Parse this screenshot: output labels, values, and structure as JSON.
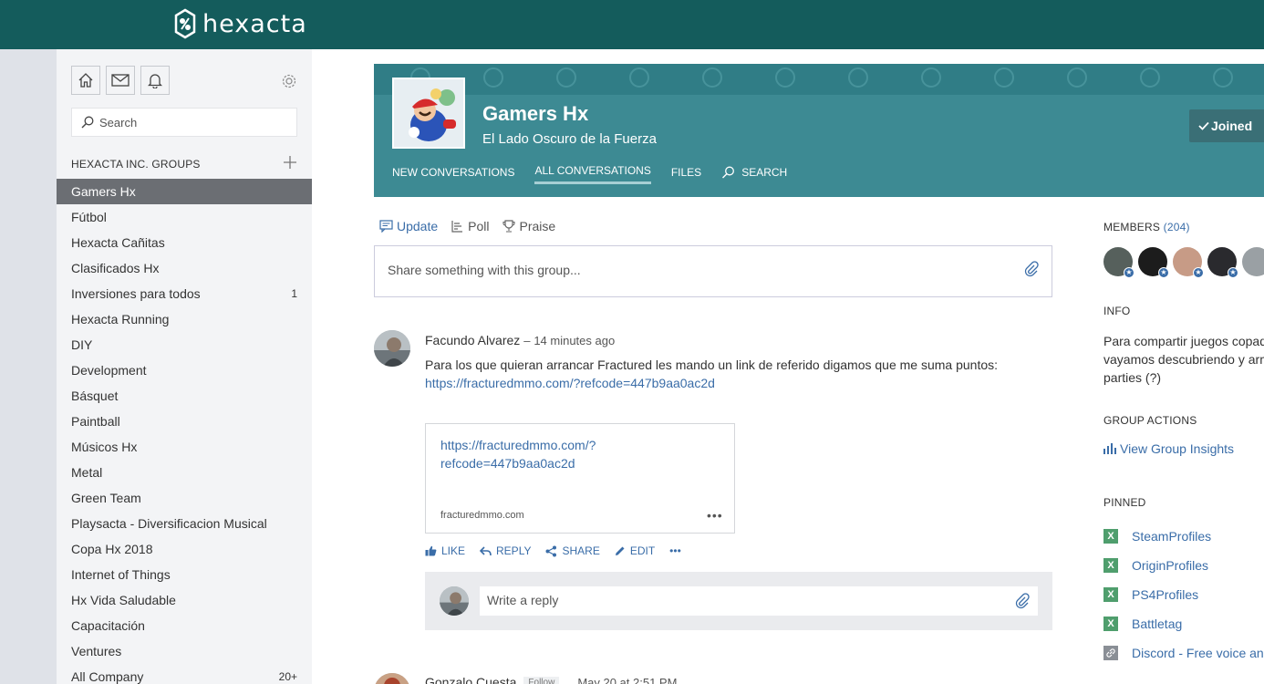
{
  "app": {
    "brand": "hexacta",
    "accent": "#145c5c",
    "link_color": "#3a6da8"
  },
  "sidebar": {
    "search_placeholder": "Search",
    "groups_heading": "HEXACTA INC. GROUPS",
    "groups": [
      {
        "label": "Gamers Hx",
        "count": "",
        "active": true
      },
      {
        "label": "Fútbol",
        "count": ""
      },
      {
        "label": "Hexacta Cañitas",
        "count": ""
      },
      {
        "label": "Clasificados Hx",
        "count": ""
      },
      {
        "label": "Inversiones para todos",
        "count": "1"
      },
      {
        "label": "Hexacta Running",
        "count": ""
      },
      {
        "label": "DIY",
        "count": ""
      },
      {
        "label": "Development",
        "count": ""
      },
      {
        "label": "Básquet",
        "count": ""
      },
      {
        "label": "Paintball",
        "count": ""
      },
      {
        "label": "Músicos Hx",
        "count": ""
      },
      {
        "label": "Metal",
        "count": ""
      },
      {
        "label": "Green Team",
        "count": ""
      },
      {
        "label": "Playsacta - Diversificacion Musical",
        "count": ""
      },
      {
        "label": "Copa Hx 2018",
        "count": ""
      },
      {
        "label": "Internet of Things",
        "count": ""
      },
      {
        "label": "Hx Vida Saludable",
        "count": ""
      },
      {
        "label": "Capacitación",
        "count": ""
      },
      {
        "label": "Ventures",
        "count": ""
      },
      {
        "label": "All Company",
        "count": "20+"
      }
    ]
  },
  "group": {
    "title": "Gamers Hx",
    "subtitle": "El Lado Oscuro de la Fuerza",
    "joined_label": "Joined",
    "tabs": [
      "NEW CONVERSATIONS",
      "ALL CONVERSATIONS",
      "FILES",
      "SEARCH"
    ]
  },
  "publisher": {
    "tabs": [
      "Update",
      "Poll",
      "Praise"
    ],
    "placeholder": "Share something with this group..."
  },
  "post": {
    "author": "Facundo Alvarez",
    "separator": "–",
    "time": "14 minutes ago",
    "text": "Para los que quieran arrancar Fractured les mando un link de referido digamos que me suma puntos:",
    "link": "https://fracturedmmo.com/?refcode=447b9aa0ac2d",
    "card": {
      "url_line1": "https://fracturedmmo.com/?",
      "url_line2": "refcode=447b9aa0ac2d",
      "domain": "fracturedmmo.com",
      "more": "•••"
    },
    "actions": {
      "like": "LIKE",
      "reply": "REPLY",
      "share": "SHARE",
      "edit": "EDIT",
      "more": "•••"
    },
    "reply_placeholder": "Write a reply"
  },
  "next_post": {
    "author": "Gonzalo Cuesta",
    "badge": "Follow",
    "time": "May 20 at 2:51 PM"
  },
  "rail": {
    "members_heading": "MEMBERS",
    "members_count": "(204)",
    "info_heading": "INFO",
    "info_lines": [
      "Para compartir juegos copad",
      "vayamos descubriendo y arm",
      "parties (?)"
    ],
    "actions_heading": "GROUP ACTIONS",
    "insights_label": "View Group Insights",
    "pinned_heading": "PINNED",
    "pinned": [
      {
        "label": "SteamProfiles",
        "icon": "X",
        "kind": "excel"
      },
      {
        "label": "OriginProfiles",
        "icon": "X",
        "kind": "excel"
      },
      {
        "label": "PS4Profiles",
        "icon": "X",
        "kind": "excel"
      },
      {
        "label": "Battletag",
        "icon": "X",
        "kind": "excel"
      },
      {
        "label": "Discord - Free voice and",
        "icon": "link",
        "kind": "link"
      }
    ]
  }
}
